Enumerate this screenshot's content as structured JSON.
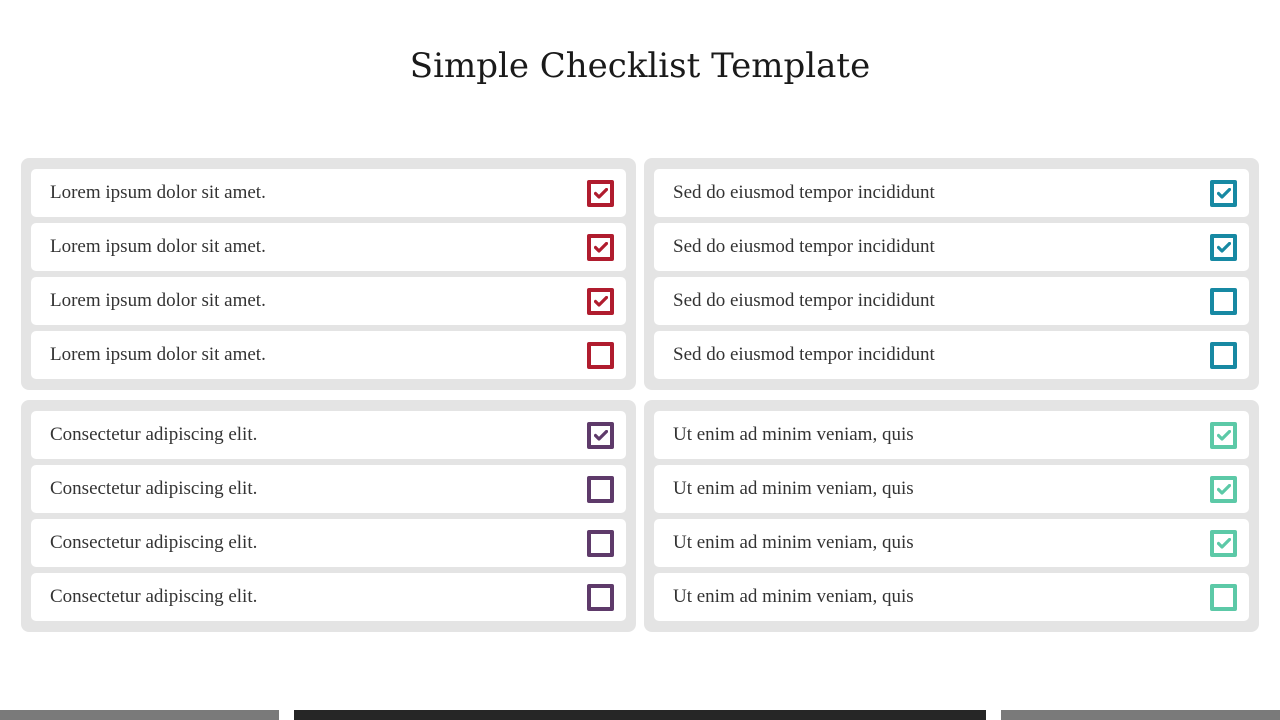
{
  "title": "Simple Checklist Template",
  "panels": [
    {
      "color": "#b01c2e",
      "items": [
        {
          "label": "Lorem ipsum dolor sit amet.",
          "checked": true
        },
        {
          "label": "Lorem ipsum dolor sit amet.",
          "checked": true
        },
        {
          "label": "Lorem ipsum dolor sit amet.",
          "checked": true
        },
        {
          "label": "Lorem ipsum dolor sit amet.",
          "checked": false
        }
      ]
    },
    {
      "color": "#1789a3",
      "items": [
        {
          "label": "Sed do eiusmod tempor incididunt",
          "checked": true
        },
        {
          "label": "Sed do eiusmod tempor incididunt",
          "checked": true
        },
        {
          "label": "Sed do eiusmod tempor incididunt",
          "checked": false
        },
        {
          "label": "Sed do eiusmod tempor incididunt",
          "checked": false
        }
      ]
    },
    {
      "color": "#5e3a6a",
      "items": [
        {
          "label": "Consectetur adipiscing elit.",
          "checked": true
        },
        {
          "label": "Consectetur adipiscing elit.",
          "checked": false
        },
        {
          "label": "Consectetur adipiscing elit.",
          "checked": false
        },
        {
          "label": "Consectetur adipiscing elit.",
          "checked": false
        }
      ]
    },
    {
      "color": "#5cc9a7",
      "items": [
        {
          "label": "Ut enim ad minim veniam, quis",
          "checked": true
        },
        {
          "label": "Ut enim ad minim veniam, quis",
          "checked": true
        },
        {
          "label": "Ut enim ad minim veniam, quis",
          "checked": true
        },
        {
          "label": "Ut enim ad minim veniam, quis",
          "checked": false
        }
      ]
    }
  ]
}
